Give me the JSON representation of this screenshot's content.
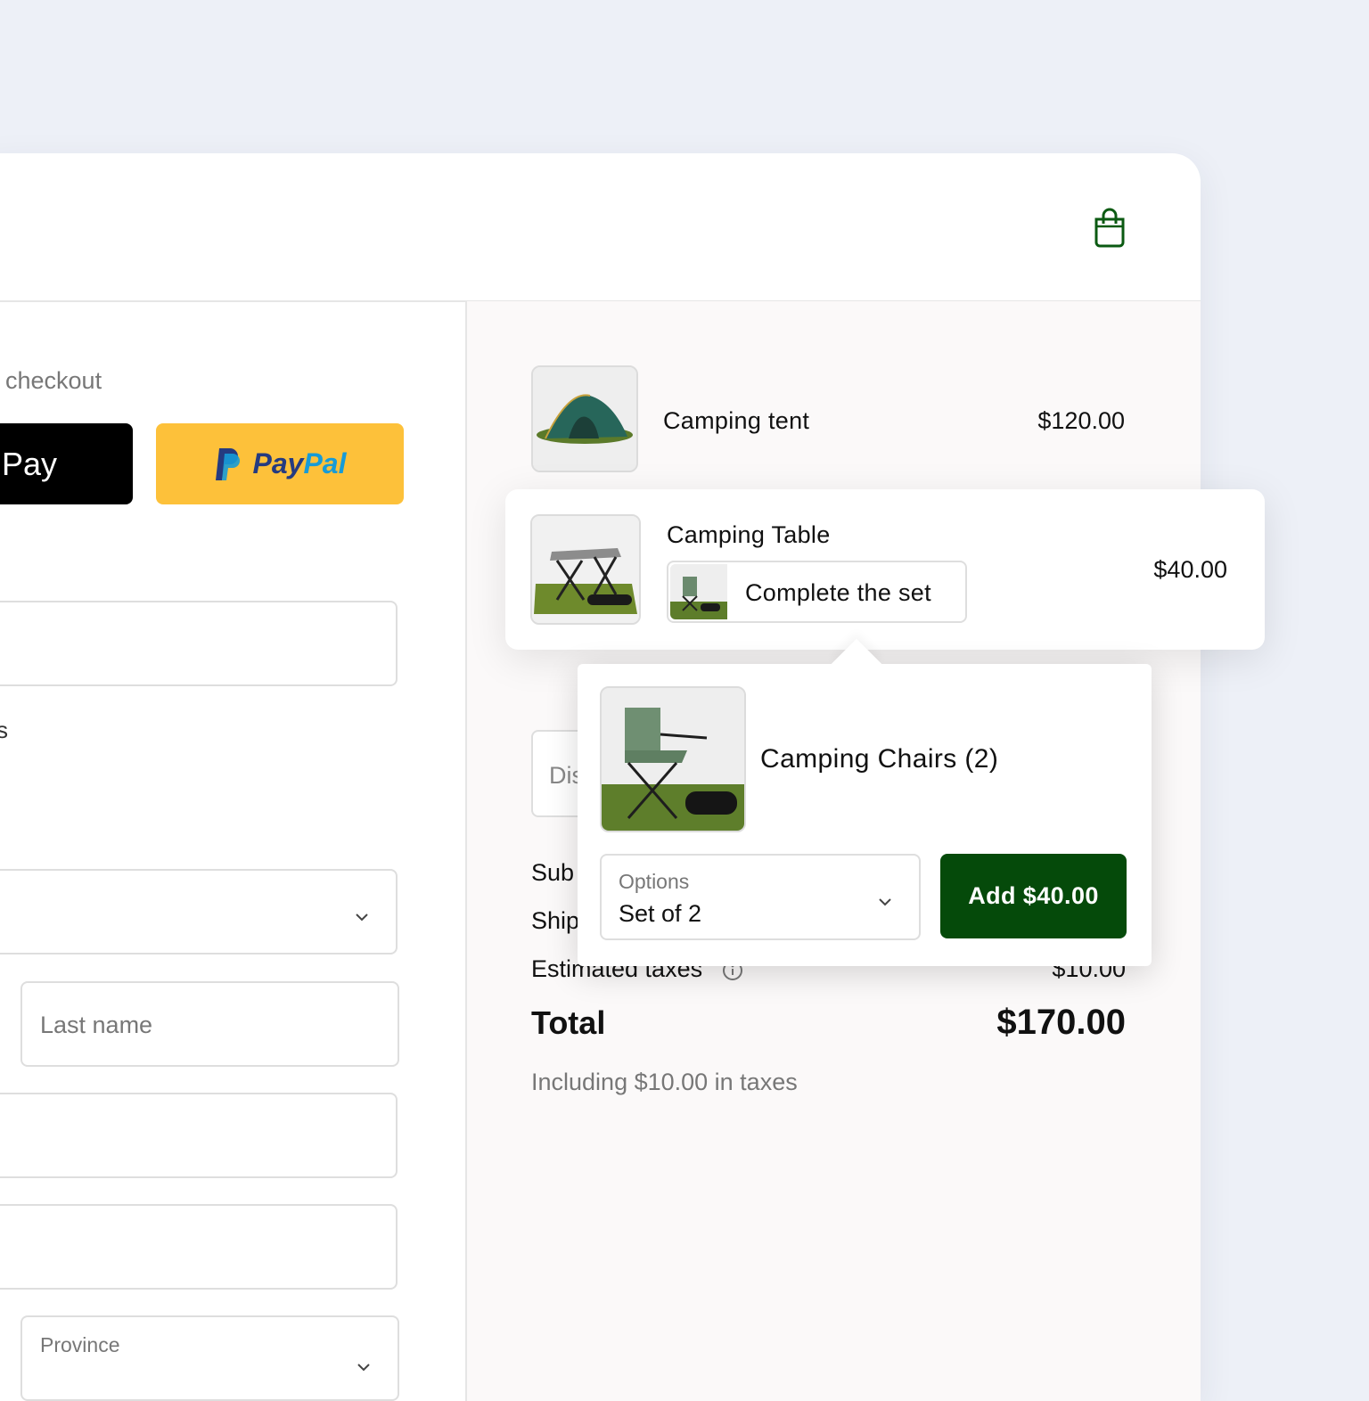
{
  "express_checkout": {
    "label": "checkout",
    "apple_pay_label": "Pay",
    "paypal_label_a": "Pay",
    "paypal_label_b": "Pal"
  },
  "form": {
    "stray_text": "s",
    "last_name_placeholder": "Last name",
    "province_label": "Province"
  },
  "order": {
    "items": [
      {
        "name": "Camping tent",
        "price": "$120.00"
      },
      {
        "name": "Camping Table",
        "price": "$40.00",
        "upsell_label": "Complete the set"
      }
    ],
    "discount_placeholder": "Dis",
    "subtotal_label": "Sub",
    "shipping_label": "Ship",
    "taxes_label": "Estimated taxes",
    "taxes_value": "$10.00",
    "total_label": "Total",
    "total_value": "$170.00",
    "tax_note": "Including $10.00 in taxes"
  },
  "upsell": {
    "product_name": "Camping Chairs (2)",
    "options_label": "Options",
    "options_value": "Set of 2",
    "add_button_label": "Add $40.00"
  },
  "colors": {
    "accent_green": "#054a0a",
    "paypal_yellow": "#fdc13a",
    "background": "#edf0f7"
  }
}
